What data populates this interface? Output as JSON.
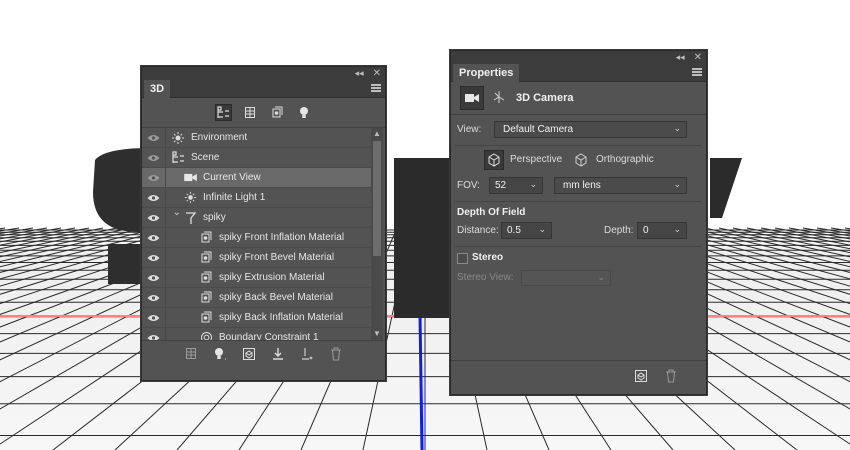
{
  "canvas": {
    "background": "#ffffff",
    "floor_line_color": "#2a2a2a",
    "axis_x_color": "#ff8080",
    "axis_z_color": "#0a1cff",
    "text_color": "#2c2c2c"
  },
  "panel3d": {
    "tab_label": "3D",
    "collapse_icon": "double-chevron-left",
    "close_icon": "close-x",
    "filter_buttons": [
      "whole-scene-icon",
      "meshes-icon",
      "materials-icon",
      "lights-icon"
    ],
    "rows": [
      {
        "label": "Environment",
        "icon": "environment-icon",
        "indent": 0,
        "visible_dim": true
      },
      {
        "label": "Scene",
        "icon": "scene-icon",
        "indent": 0,
        "visible_dim": true
      },
      {
        "label": "Current View",
        "icon": "camera-icon",
        "indent": 1,
        "visible_dim": true,
        "selected": true
      },
      {
        "label": "Infinite Light 1",
        "icon": "infinite-light-icon",
        "indent": 1
      },
      {
        "label": "spiky",
        "icon": "mesh-icon",
        "indent": 1,
        "expanded": true
      },
      {
        "label": "spiky Front Inflation Material",
        "icon": "material-icon",
        "indent": 2
      },
      {
        "label": "spiky Front Bevel Material",
        "icon": "material-icon",
        "indent": 2
      },
      {
        "label": "spiky Extrusion Material",
        "icon": "material-icon",
        "indent": 2
      },
      {
        "label": "spiky Back Bevel Material",
        "icon": "material-icon",
        "indent": 2
      },
      {
        "label": "spiky Back Inflation Material",
        "icon": "material-icon",
        "indent": 2
      },
      {
        "label": "Boundary Constraint 1",
        "icon": "constraint-icon",
        "indent": 2
      }
    ],
    "bottom_buttons": [
      "render-icon",
      "add-light-icon",
      "new-object-icon",
      "drop-to-ground-icon",
      "constraint-add-icon",
      "delete-icon"
    ]
  },
  "properties": {
    "tab_label": "Properties",
    "header_title": "3D Camera",
    "view_label": "View:",
    "view_value": "Default Camera",
    "perspective_label": "Perspective",
    "orthographic_label": "Orthographic",
    "fov_label": "FOV:",
    "fov_value": "52",
    "fov_units": "mm lens",
    "dof_title": "Depth Of Field",
    "distance_label": "Distance:",
    "distance_value": "0.5",
    "depth_label": "Depth:",
    "depth_value": "0",
    "stereo_label": "Stereo",
    "stereo_view_label": "Stereo View:",
    "stereo_view_value": ""
  }
}
